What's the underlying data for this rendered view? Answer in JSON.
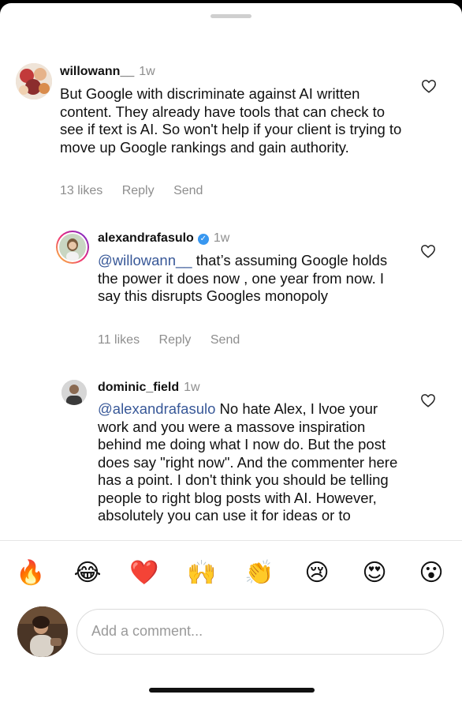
{
  "comments": [
    {
      "username": "willowann__",
      "time": "1w",
      "text": "But Google with discriminate against AI written content. They already have tools that can check to see if text is AI. So won't help if your client is trying to move up Google rankings and gain authority.",
      "likes": "13 likes",
      "reply": "Reply",
      "send": "Send"
    },
    {
      "username": "alexandrafasulo",
      "verified": true,
      "time": "1w",
      "mention": "@willowann__",
      "text": " that’s assuming Google holds the power it does now , one year from now. I say this disrupts Googles monopoly",
      "likes": "11 likes",
      "reply": "Reply",
      "send": "Send"
    },
    {
      "username": "dominic_field",
      "time": "1w",
      "mention": "@alexandrafasulo",
      "text": " No hate Alex, I lvoe your work and you were a massove inspiration behind me doing what I now do. But the post does say \"right now\". And the commenter here has a point. I don't think you should be telling people to right blog posts with AI. However, absolutely you can use it for ideas or to"
    }
  ],
  "emoji_bar": [
    "🔥",
    "😂",
    "❤️",
    "🙌",
    "👏",
    "😢",
    "😍",
    "😮"
  ],
  "composer": {
    "placeholder": "Add a comment..."
  },
  "icons": {
    "like": "heart-outline-icon",
    "verified": "verified-badge-icon"
  },
  "colors": {
    "mention": "#385898",
    "muted": "#8e8e8e",
    "verified": "#3897f0"
  }
}
